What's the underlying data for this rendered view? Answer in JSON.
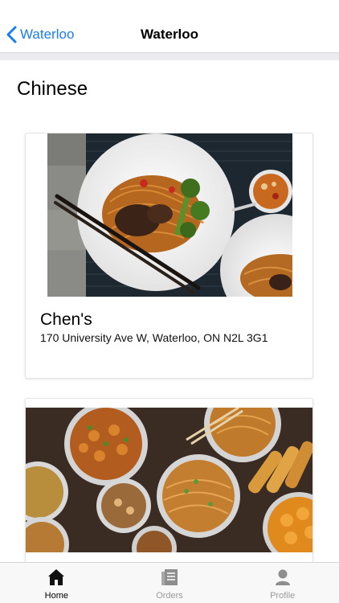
{
  "nav": {
    "back_label": "Waterloo",
    "title": "Waterloo"
  },
  "section": {
    "title": "Chinese"
  },
  "restaurants": [
    {
      "name": "Chen's",
      "address": "170 University Ave W, Waterloo, ON N2L 3G1",
      "photo_icon": "noodle-plate-photo"
    },
    {
      "name": "",
      "address": "",
      "photo_icon": "chinese-feast-photo"
    }
  ],
  "tabs": [
    {
      "label": "Home",
      "icon": "home-icon",
      "active": true
    },
    {
      "label": "Orders",
      "icon": "orders-icon",
      "active": false
    },
    {
      "label": "Profile",
      "icon": "profile-icon",
      "active": false
    }
  ],
  "colors": {
    "accent": "#1a7cf0",
    "tab_active": "#000000",
    "tab_inactive": "#9a9a9a"
  }
}
